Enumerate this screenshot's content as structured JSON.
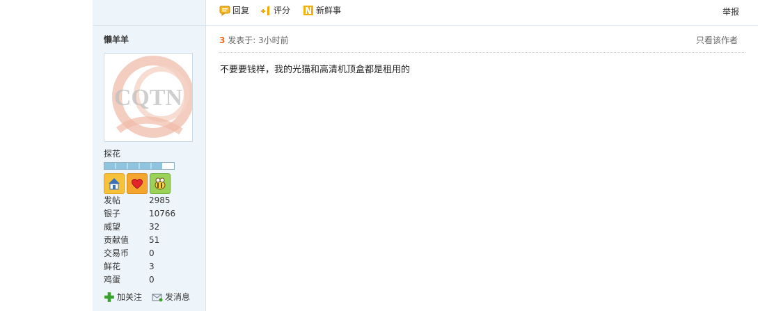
{
  "actions": {
    "reply_label": "回复",
    "rate_label": "评分",
    "fresh_label": "新鲜事",
    "report_label": "举报"
  },
  "user": {
    "name": "懒羊羊",
    "avatar_watermark": "CQTN",
    "rank": "探花",
    "level_progress": 0.83,
    "medals": [
      "home-medal-icon",
      "heart-medal-icon",
      "bee-medal-icon"
    ],
    "stats": [
      {
        "label": "发帖",
        "value": "2985"
      },
      {
        "label": "银子",
        "value": "10766"
      },
      {
        "label": "威望",
        "value": "32"
      },
      {
        "label": "贡献值",
        "value": "51"
      },
      {
        "label": "交易币",
        "value": "0"
      },
      {
        "label": "鲜花",
        "value": "3"
      },
      {
        "label": "鸡蛋",
        "value": "0"
      }
    ],
    "follow_label": "加关注",
    "message_label": "发消息"
  },
  "post": {
    "floor": "3",
    "posted_at": "发表于: 3小时前",
    "only_author_label": "只看该作者",
    "content": "不要要钱样，我的光猫和高清机顶盒都是租用的"
  },
  "colors": {
    "sidebar_bg": "#eef5fa",
    "floor_accent": "#f26c22"
  }
}
